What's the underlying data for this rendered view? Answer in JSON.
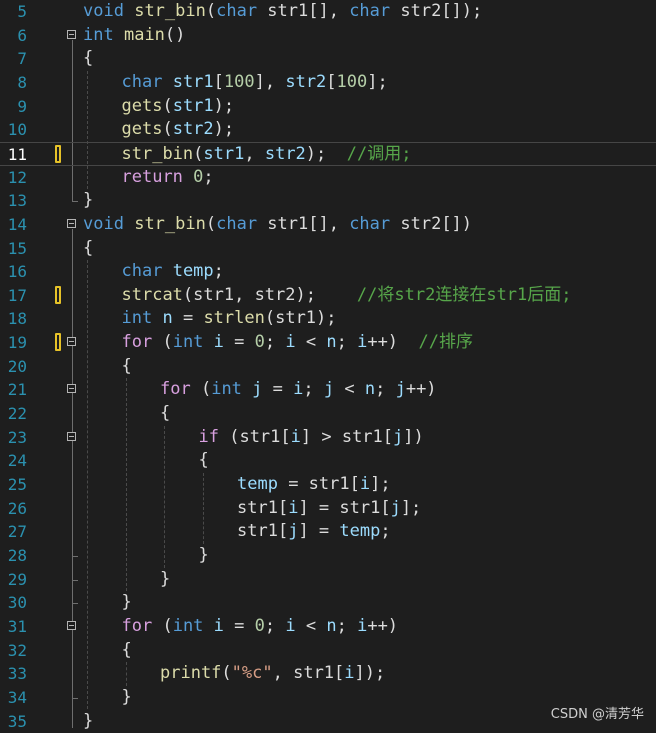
{
  "editor": {
    "current_line": 11,
    "lines": [
      {
        "n": 5,
        "indent": 0,
        "tokens": [
          [
            "kw",
            "void"
          ],
          [
            "p",
            " "
          ],
          [
            "fn",
            "str_bin"
          ],
          [
            "p",
            "("
          ],
          [
            "kw",
            "char"
          ],
          [
            "p",
            " str1[], "
          ],
          [
            "kw",
            "char"
          ],
          [
            "p",
            " str2[]);"
          ]
        ]
      },
      {
        "n": 6,
        "indent": 0,
        "fold": true,
        "tokens": [
          [
            "kw",
            "int"
          ],
          [
            "p",
            " "
          ],
          [
            "fn",
            "main"
          ],
          [
            "p",
            "()"
          ]
        ]
      },
      {
        "n": 7,
        "indent": 0,
        "tokens": [
          [
            "p",
            "{"
          ]
        ]
      },
      {
        "n": 8,
        "indent": 1,
        "tokens": [
          [
            "kw",
            "char"
          ],
          [
            "p",
            " "
          ],
          [
            "var",
            "str1"
          ],
          [
            "p",
            "["
          ],
          [
            "num",
            "100"
          ],
          [
            "p",
            "], "
          ],
          [
            "var",
            "str2"
          ],
          [
            "p",
            "["
          ],
          [
            "num",
            "100"
          ],
          [
            "p",
            "];"
          ]
        ]
      },
      {
        "n": 9,
        "indent": 1,
        "tokens": [
          [
            "fn",
            "gets"
          ],
          [
            "p",
            "("
          ],
          [
            "var",
            "str1"
          ],
          [
            "p",
            ");"
          ]
        ]
      },
      {
        "n": 10,
        "indent": 1,
        "tokens": [
          [
            "fn",
            "gets"
          ],
          [
            "p",
            "("
          ],
          [
            "var",
            "str2"
          ],
          [
            "p",
            ");"
          ]
        ]
      },
      {
        "n": 11,
        "indent": 1,
        "mark": true,
        "tokens": [
          [
            "fn",
            "str_bin"
          ],
          [
            "p",
            "("
          ],
          [
            "var",
            "str1"
          ],
          [
            "p",
            ", "
          ],
          [
            "var",
            "str2"
          ],
          [
            "p",
            ");  "
          ],
          [
            "cmt",
            "//调用;"
          ]
        ]
      },
      {
        "n": 12,
        "indent": 1,
        "tokens": [
          [
            "ctl",
            "return"
          ],
          [
            "p",
            " "
          ],
          [
            "num",
            "0"
          ],
          [
            "p",
            ";"
          ]
        ]
      },
      {
        "n": 13,
        "indent": 0,
        "tokens": [
          [
            "p",
            "}"
          ]
        ]
      },
      {
        "n": 14,
        "indent": 0,
        "fold": true,
        "tokens": [
          [
            "kw",
            "void"
          ],
          [
            "p",
            " "
          ],
          [
            "fn",
            "str_bin"
          ],
          [
            "p",
            "("
          ],
          [
            "kw",
            "char"
          ],
          [
            "p",
            " str1[], "
          ],
          [
            "kw",
            "char"
          ],
          [
            "p",
            " str2[])"
          ]
        ]
      },
      {
        "n": 15,
        "indent": 0,
        "tokens": [
          [
            "p",
            "{"
          ]
        ]
      },
      {
        "n": 16,
        "indent": 1,
        "tokens": [
          [
            "kw",
            "char"
          ],
          [
            "p",
            " "
          ],
          [
            "var",
            "temp"
          ],
          [
            "p",
            ";"
          ]
        ]
      },
      {
        "n": 17,
        "indent": 1,
        "mark": true,
        "tokens": [
          [
            "fn",
            "strcat"
          ],
          [
            "p",
            "(str1, str2);    "
          ],
          [
            "cmt",
            "//将str2连接在str1后面;"
          ]
        ]
      },
      {
        "n": 18,
        "indent": 1,
        "tokens": [
          [
            "kw",
            "int"
          ],
          [
            "p",
            " "
          ],
          [
            "var",
            "n"
          ],
          [
            "p",
            " = "
          ],
          [
            "fn",
            "strlen"
          ],
          [
            "p",
            "(str1);"
          ]
        ]
      },
      {
        "n": 19,
        "indent": 1,
        "mark": true,
        "fold": true,
        "tokens": [
          [
            "ctl",
            "for"
          ],
          [
            "p",
            " ("
          ],
          [
            "kw",
            "int"
          ],
          [
            "p",
            " "
          ],
          [
            "var",
            "i"
          ],
          [
            "p",
            " = "
          ],
          [
            "num",
            "0"
          ],
          [
            "p",
            "; "
          ],
          [
            "var",
            "i"
          ],
          [
            "p",
            " < "
          ],
          [
            "var",
            "n"
          ],
          [
            "p",
            "; "
          ],
          [
            "var",
            "i"
          ],
          [
            "p",
            "++)  "
          ],
          [
            "cmt",
            "//排序"
          ]
        ]
      },
      {
        "n": 20,
        "indent": 1,
        "tokens": [
          [
            "p",
            "{"
          ]
        ]
      },
      {
        "n": 21,
        "indent": 2,
        "fold": true,
        "tokens": [
          [
            "ctl",
            "for"
          ],
          [
            "p",
            " ("
          ],
          [
            "kw",
            "int"
          ],
          [
            "p",
            " "
          ],
          [
            "var",
            "j"
          ],
          [
            "p",
            " = "
          ],
          [
            "var",
            "i"
          ],
          [
            "p",
            "; "
          ],
          [
            "var",
            "j"
          ],
          [
            "p",
            " < "
          ],
          [
            "var",
            "n"
          ],
          [
            "p",
            "; "
          ],
          [
            "var",
            "j"
          ],
          [
            "p",
            "++)"
          ]
        ]
      },
      {
        "n": 22,
        "indent": 2,
        "tokens": [
          [
            "p",
            "{"
          ]
        ]
      },
      {
        "n": 23,
        "indent": 3,
        "fold": true,
        "tokens": [
          [
            "ctl",
            "if"
          ],
          [
            "p",
            " (str1["
          ],
          [
            "var",
            "i"
          ],
          [
            "p",
            "] > str1["
          ],
          [
            "var",
            "j"
          ],
          [
            "p",
            "])"
          ]
        ]
      },
      {
        "n": 24,
        "indent": 3,
        "tokens": [
          [
            "p",
            "{"
          ]
        ]
      },
      {
        "n": 25,
        "indent": 4,
        "tokens": [
          [
            "var",
            "temp"
          ],
          [
            "p",
            " = str1["
          ],
          [
            "var",
            "i"
          ],
          [
            "p",
            "];"
          ]
        ]
      },
      {
        "n": 26,
        "indent": 4,
        "tokens": [
          [
            "p",
            "str1["
          ],
          [
            "var",
            "i"
          ],
          [
            "p",
            "] = str1["
          ],
          [
            "var",
            "j"
          ],
          [
            "p",
            "];"
          ]
        ]
      },
      {
        "n": 27,
        "indent": 4,
        "tokens": [
          [
            "p",
            "str1["
          ],
          [
            "var",
            "j"
          ],
          [
            "p",
            "] = "
          ],
          [
            "var",
            "temp"
          ],
          [
            "p",
            ";"
          ]
        ]
      },
      {
        "n": 28,
        "indent": 3,
        "tokens": [
          [
            "p",
            "}"
          ]
        ]
      },
      {
        "n": 29,
        "indent": 2,
        "tokens": [
          [
            "p",
            "}"
          ]
        ]
      },
      {
        "n": 30,
        "indent": 1,
        "tokens": [
          [
            "p",
            "}"
          ]
        ]
      },
      {
        "n": 31,
        "indent": 1,
        "fold": true,
        "tokens": [
          [
            "ctl",
            "for"
          ],
          [
            "p",
            " ("
          ],
          [
            "kw",
            "int"
          ],
          [
            "p",
            " "
          ],
          [
            "var",
            "i"
          ],
          [
            "p",
            " = "
          ],
          [
            "num",
            "0"
          ],
          [
            "p",
            "; "
          ],
          [
            "var",
            "i"
          ],
          [
            "p",
            " < "
          ],
          [
            "var",
            "n"
          ],
          [
            "p",
            "; "
          ],
          [
            "var",
            "i"
          ],
          [
            "p",
            "++)"
          ]
        ]
      },
      {
        "n": 32,
        "indent": 1,
        "tokens": [
          [
            "p",
            "{"
          ]
        ]
      },
      {
        "n": 33,
        "indent": 2,
        "tokens": [
          [
            "fn",
            "printf"
          ],
          [
            "p",
            "("
          ],
          [
            "str",
            "\"%c\""
          ],
          [
            "p",
            ", str1["
          ],
          [
            "var",
            "i"
          ],
          [
            "p",
            "]);"
          ]
        ]
      },
      {
        "n": 34,
        "indent": 1,
        "tokens": [
          [
            "p",
            "}"
          ]
        ]
      },
      {
        "n": 35,
        "indent": 0,
        "tokens": [
          [
            "p",
            "}"
          ]
        ]
      }
    ]
  },
  "watermark": "CSDN @清芳华",
  "colors": {
    "background": "#1e1e1e",
    "line_number": "#2b91af",
    "keyword": "#569cd6",
    "control_keyword": "#d8a0df",
    "function": "#dcdcaa",
    "variable": "#9cdcfe",
    "number": "#b5cea8",
    "string": "#d69d85",
    "comment": "#57a64a",
    "change_marker": "#e6c228"
  }
}
